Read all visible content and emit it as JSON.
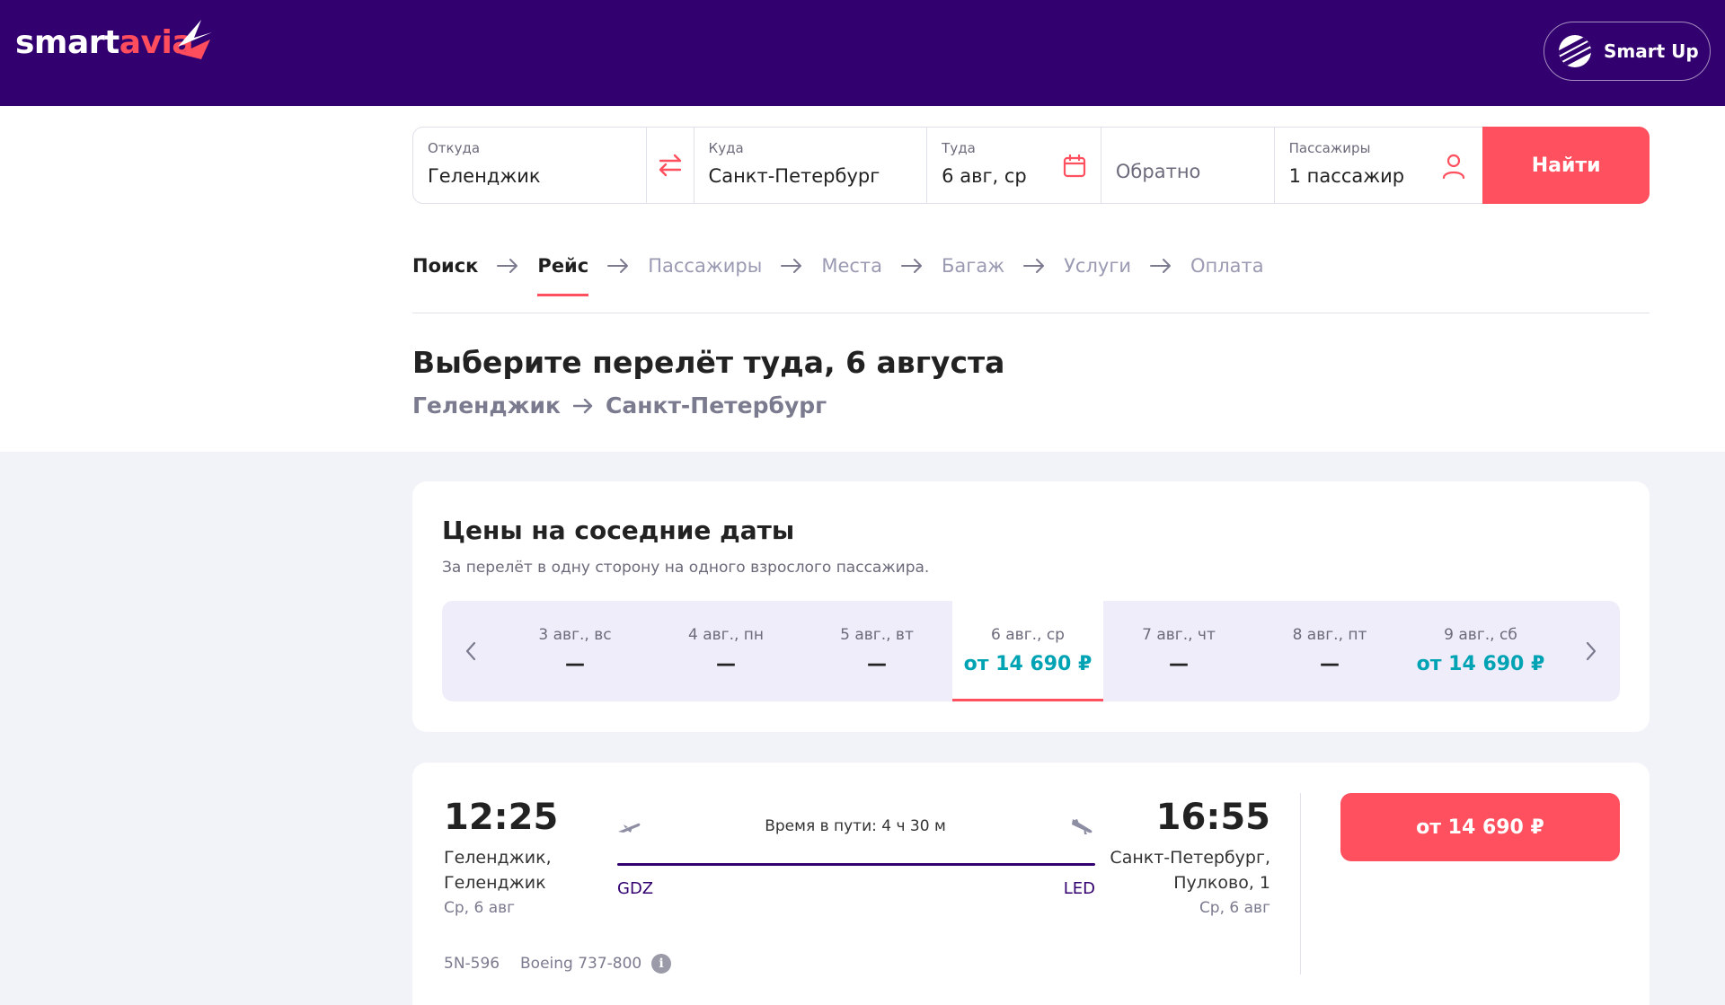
{
  "header": {
    "logo_main": "smart",
    "logo_accent": "avia",
    "smartup_label": "Smart Up"
  },
  "search": {
    "from_label": "Откуда",
    "from_value": "Геленджик",
    "to_label": "Куда",
    "to_value": "Санкт-Петербург",
    "date_label": "Туда",
    "date_value": "6 авг, ср",
    "return_placeholder": "Обратно",
    "pax_label": "Пассажиры",
    "pax_value": "1 пассажир",
    "search_button": "Найти"
  },
  "steps": [
    "Поиск",
    "Рейс",
    "Пассажиры",
    "Места",
    "Багаж",
    "Услуги",
    "Оплата"
  ],
  "page": {
    "title": "Выберите перелёт туда, 6 августа",
    "route_from": "Геленджик",
    "route_to": "Санкт-Петербург"
  },
  "prices": {
    "title": "Цены на соседние даты",
    "subtitle": "За перелёт в одну сторону на одного взрослого пассажира.",
    "days": [
      {
        "label": "3 авг., вс",
        "price": "—"
      },
      {
        "label": "4 авг., пн",
        "price": "—"
      },
      {
        "label": "5 авг., вт",
        "price": "—"
      },
      {
        "label": "6 авг., ср",
        "price": "от 14 690 ₽"
      },
      {
        "label": "7 авг., чт",
        "price": "—"
      },
      {
        "label": "8 авг., пт",
        "price": "—"
      },
      {
        "label": "9 авг., сб",
        "price": "от 14 690 ₽"
      }
    ]
  },
  "flight": {
    "dep_time": "12:25",
    "dep_city_line1": "Геленджик,",
    "dep_city_line2": "Геленджик",
    "dep_date": "Ср, 6 авг",
    "duration": "Время в пути: 4 ч 30 м",
    "dep_iata": "GDZ",
    "arr_iata": "LED",
    "arr_time": "16:55",
    "arr_city_line1": "Санкт-Петербург,",
    "arr_city_line2": "Пулково, 1",
    "arr_date": "Ср, 6 авг",
    "flight_number": "5N-596",
    "aircraft": "Boeing 737-800",
    "info_glyph": "i",
    "price_button": "от 14 690 ₽"
  },
  "colors": {
    "brand_purple": "#330070",
    "accent_red": "#ff505f",
    "price_teal": "#00a3b4"
  }
}
